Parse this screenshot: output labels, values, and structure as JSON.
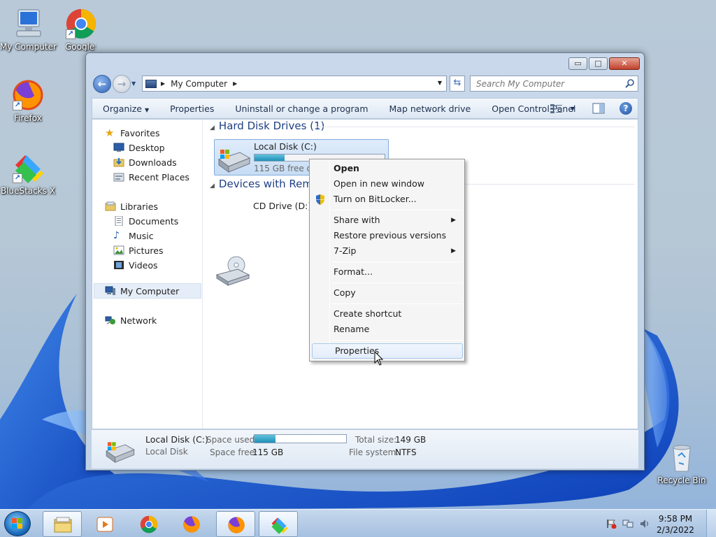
{
  "desktop": {
    "icons": [
      {
        "label": "My Computer"
      },
      {
        "label": "Google Chro"
      },
      {
        "label": "Firefox"
      },
      {
        "label": "BlueStacks X"
      },
      {
        "label": "Recycle Bin"
      }
    ]
  },
  "window": {
    "title": "My Computer",
    "controls": {
      "minimize": "▭",
      "maximize": "□",
      "close": "✕"
    },
    "address": {
      "crumb": "My Computer"
    },
    "search": {
      "placeholder": "Search My Computer"
    },
    "toolbar": {
      "organize": "Organize",
      "properties": "Properties",
      "uninstall": "Uninstall or change a program",
      "map_drive": "Map network drive",
      "control_panel": "Open Control Panel",
      "help": "?"
    },
    "nav": {
      "favorites": "Favorites",
      "desktop": "Desktop",
      "downloads": "Downloads",
      "recent": "Recent Places",
      "libraries": "Libraries",
      "documents": "Documents",
      "music": "Music",
      "pictures": "Pictures",
      "videos": "Videos",
      "computer": "My Computer",
      "network": "Network"
    },
    "groups": {
      "hdd_title": "Hard Disk Drives (1)",
      "removable_title": "Devices with Remov"
    },
    "drive_c": {
      "name": "Local Disk (C:)",
      "free_text": "115 GB free of 1",
      "used_fraction": 0.23
    },
    "drive_d": {
      "name": "CD Drive (D:)"
    },
    "details": {
      "name": "Local Disk (C:)",
      "type": "Local Disk",
      "space_used_label": "Space used:",
      "space_free_label": "Space free:",
      "space_free_value": "115 GB",
      "total_size_label": "Total size:",
      "total_size_value": "149 GB",
      "file_system_label": "File system:",
      "file_system_value": "NTFS",
      "used_fraction": 0.23
    }
  },
  "context_menu": {
    "items": [
      {
        "label": "Open"
      },
      {
        "label": "Open in new window"
      },
      {
        "label": "Turn on BitLocker..."
      },
      {
        "label": "Share with"
      },
      {
        "label": "Restore previous versions"
      },
      {
        "label": "7-Zip"
      },
      {
        "label": "Format..."
      },
      {
        "label": "Copy"
      },
      {
        "label": "Create shortcut"
      },
      {
        "label": "Rename"
      },
      {
        "label": "Properties"
      }
    ]
  },
  "taskbar": {
    "clock_time": "9:58 PM",
    "clock_date": "2/3/2022"
  },
  "colors": {
    "accent": "#1e3f85",
    "selection": "#c7dcf4",
    "drive_fill": "#1f8fb8"
  }
}
